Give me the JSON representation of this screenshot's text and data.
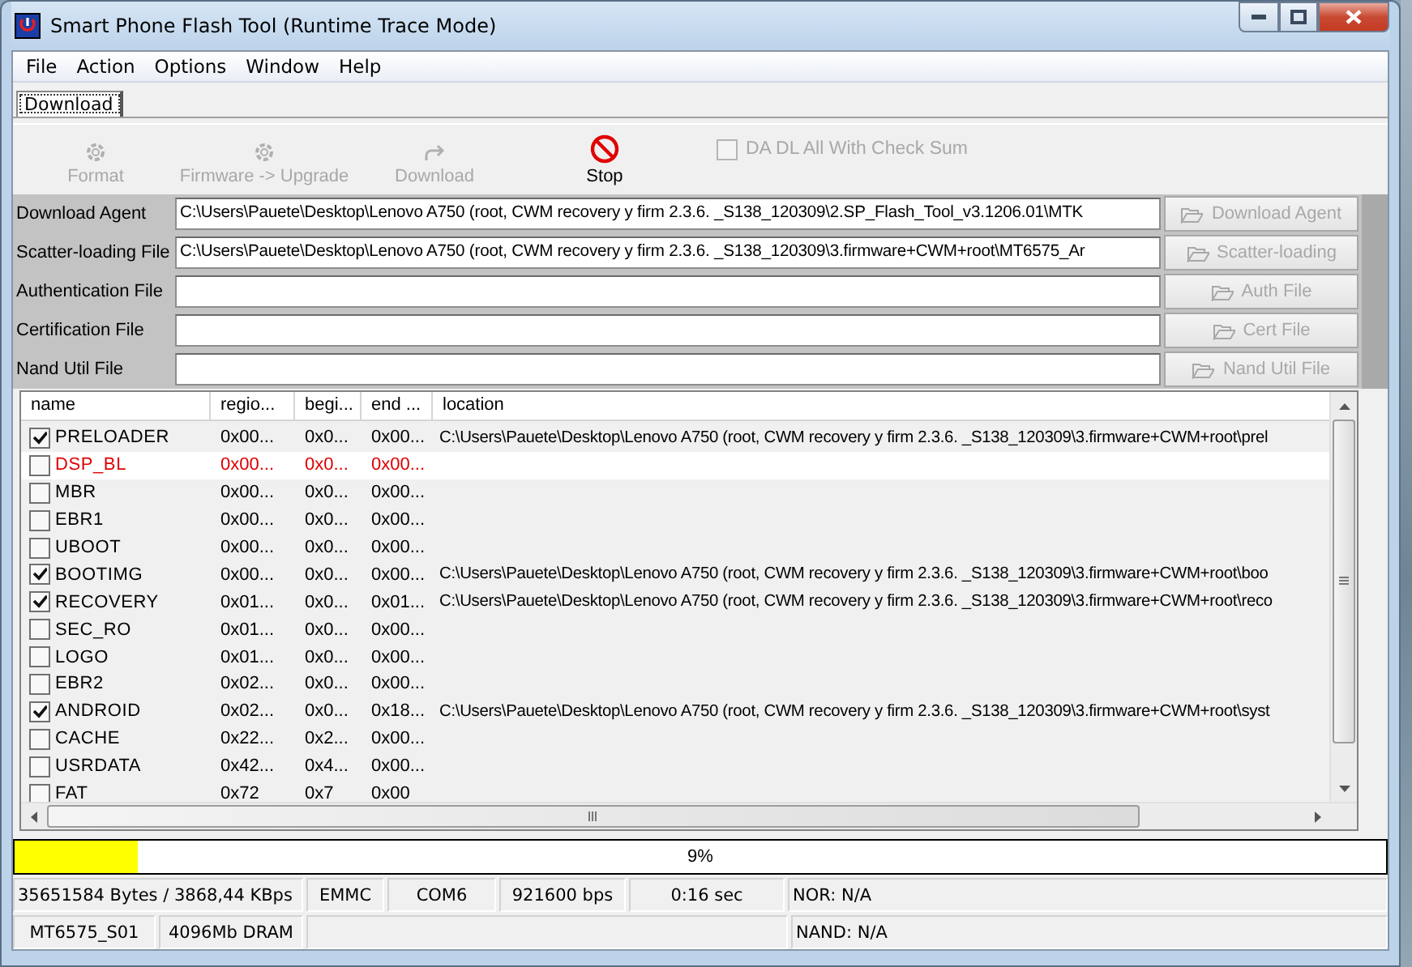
{
  "window": {
    "title": "Smart Phone Flash Tool (Runtime Trace Mode)"
  },
  "menu": [
    "File",
    "Action",
    "Options",
    "Window",
    "Help"
  ],
  "tabs": [
    {
      "label": "Download",
      "selected": true
    }
  ],
  "toolbar": [
    {
      "label": "Format",
      "kind": "gear",
      "disabled": true
    },
    {
      "label": "Firmware -> Upgrade",
      "kind": "gear",
      "disabled": true
    },
    {
      "label": "Download",
      "kind": "redo",
      "disabled": true
    },
    {
      "label": "Stop",
      "kind": "stop",
      "disabled": false
    }
  ],
  "checksum": {
    "label": "DA DL All With Check Sum",
    "checked": false,
    "disabled": true
  },
  "files": [
    {
      "label": "Download Agent",
      "value": "C:\\Users\\Pauete\\Desktop\\Lenovo A750 (root, CWM recovery y firm 2.3.6. _S138_120309\\2.SP_Flash_Tool_v3.1206.01\\MTK",
      "button": "Download Agent",
      "disabled": true
    },
    {
      "label": "Scatter-loading File",
      "value": "C:\\Users\\Pauete\\Desktop\\Lenovo A750 (root, CWM recovery y firm 2.3.6. _S138_120309\\3.firmware+CWM+root\\MT6575_Ar",
      "button": "Scatter-loading",
      "disabled": true
    },
    {
      "label": "Authentication File",
      "button": "Auth File",
      "disabled": true
    },
    {
      "label": "Certification File",
      "button": "Cert File",
      "disabled": true
    },
    {
      "label": "Nand Util File",
      "button": "Nand Util File",
      "disabled": true
    }
  ],
  "table": {
    "columns": [
      "name",
      "regio...",
      "begi...",
      "end ...",
      "location"
    ],
    "rows": [
      {
        "name": "PRELOADER",
        "checked": true,
        "selected": false,
        "region": "0x00...",
        "begin": "0x0...",
        "end": "0x00...",
        "location": "C:\\Users\\Pauete\\Desktop\\Lenovo A750 (root, CWM recovery y firm 2.3.6. _S138_120309\\3.firmware+CWM+root\\prel"
      },
      {
        "name": "DSP_BL",
        "checked": false,
        "selected": true,
        "region": "0x00...",
        "begin": "0x0...",
        "end": "0x00..."
      },
      {
        "name": "MBR",
        "checked": false,
        "selected": false,
        "region": "0x00...",
        "begin": "0x0...",
        "end": "0x00..."
      },
      {
        "name": "EBR1",
        "checked": false,
        "selected": false,
        "region": "0x00...",
        "begin": "0x0...",
        "end": "0x00..."
      },
      {
        "name": "UBOOT",
        "checked": false,
        "selected": false,
        "region": "0x00...",
        "begin": "0x0...",
        "end": "0x00..."
      },
      {
        "name": "BOOTIMG",
        "checked": true,
        "selected": false,
        "region": "0x00...",
        "begin": "0x0...",
        "end": "0x00...",
        "location": "C:\\Users\\Pauete\\Desktop\\Lenovo A750 (root, CWM recovery y firm 2.3.6. _S138_120309\\3.firmware+CWM+root\\boo"
      },
      {
        "name": "RECOVERY",
        "checked": true,
        "selected": false,
        "region": "0x01...",
        "begin": "0x0...",
        "end": "0x01...",
        "location": "C:\\Users\\Pauete\\Desktop\\Lenovo A750 (root, CWM recovery y firm 2.3.6. _S138_120309\\3.firmware+CWM+root\\reco"
      },
      {
        "name": "SEC_RO",
        "checked": false,
        "selected": false,
        "region": "0x01...",
        "begin": "0x0...",
        "end": "0x00..."
      },
      {
        "name": "LOGO",
        "checked": false,
        "selected": false,
        "region": "0x01...",
        "begin": "0x0...",
        "end": "0x00..."
      },
      {
        "name": "EBR2",
        "checked": false,
        "selected": false,
        "region": "0x02...",
        "begin": "0x0...",
        "end": "0x00..."
      },
      {
        "name": "ANDROID",
        "checked": true,
        "selected": false,
        "region": "0x02...",
        "begin": "0x0...",
        "end": "0x18...",
        "location": "C:\\Users\\Pauete\\Desktop\\Lenovo A750 (root, CWM recovery y firm 2.3.6. _S138_120309\\3.firmware+CWM+root\\syst"
      },
      {
        "name": "CACHE",
        "checked": false,
        "selected": false,
        "region": "0x22...",
        "begin": "0x2...",
        "end": "0x00..."
      },
      {
        "name": "USRDATA",
        "checked": false,
        "selected": false,
        "region": "0x42...",
        "begin": "0x4...",
        "end": "0x00..."
      },
      {
        "name": "FAT",
        "checked": false,
        "selected": false,
        "region": "0x72",
        "begin": "0x7",
        "end": "0x00"
      }
    ]
  },
  "progress": {
    "level": 0.09,
    "text": "9%"
  },
  "status_bar": [
    [
      "35651584 Bytes / 3868,44 KBps",
      "EMMC",
      "COM6",
      "921600 bps",
      "0:16 sec",
      "NOR: N/A"
    ],
    [
      "MT6575_S01",
      "4096Mb DRAM",
      "NAND: N/A"
    ]
  ]
}
